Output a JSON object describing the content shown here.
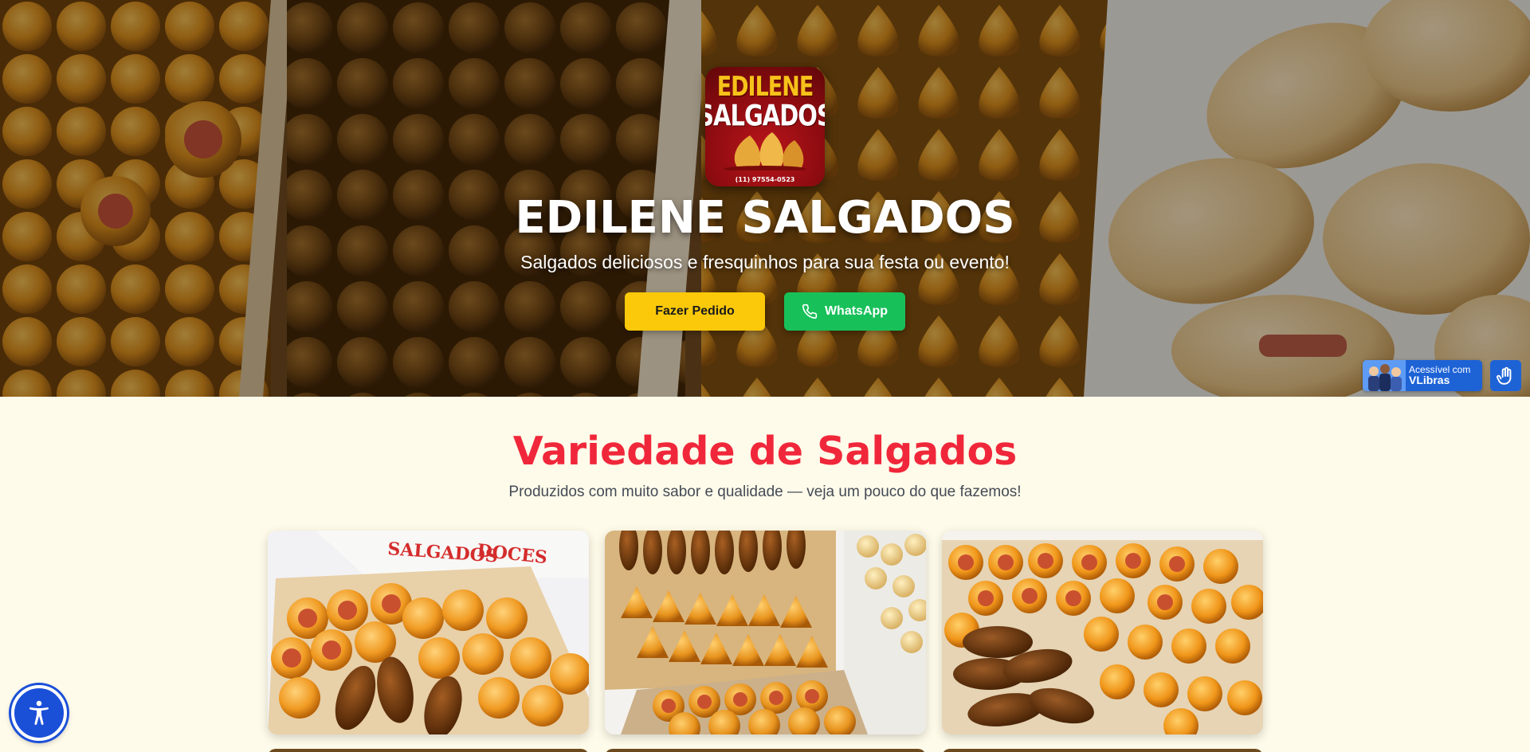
{
  "colors": {
    "accent_red": "#f0273a",
    "button_yellow": "#fbc90a",
    "whatsapp_green": "#18c05a",
    "page_background": "#fffbea",
    "vlibras_blue": "#1e63d6"
  },
  "hero": {
    "logo": {
      "line1": "EDILENE",
      "line2": "SALGADOS",
      "phone": "(11) 97554-0523"
    },
    "title": "EDILENE SALGADOS",
    "subtitle": "Salgados deliciosos e fresquinhos para sua festa ou evento!",
    "buttons": {
      "order_label": "Fazer Pedido",
      "whatsapp_label": "WhatsApp",
      "whatsapp_icon": "phone-icon"
    }
  },
  "vlibras": {
    "small_text": "Acessível com",
    "brand_text": "VLibras",
    "icon": "sign-language-hand-icon"
  },
  "section": {
    "title": "Variedade de Salgados",
    "subtitle": "Produzidos com muito sabor e qualidade — veja um pouco do que fazemos!"
  },
  "gallery": {
    "box_labels": [
      "SALGADOS",
      "DOCES"
    ],
    "items": [
      {
        "name": "coxinhas-and-mini-hot-dogs"
      },
      {
        "name": "kibes-and-coxinhas-tray"
      },
      {
        "name": "mixed-salgados-box"
      }
    ]
  },
  "accessibility_button": {
    "icon": "accessibility-person-icon"
  }
}
